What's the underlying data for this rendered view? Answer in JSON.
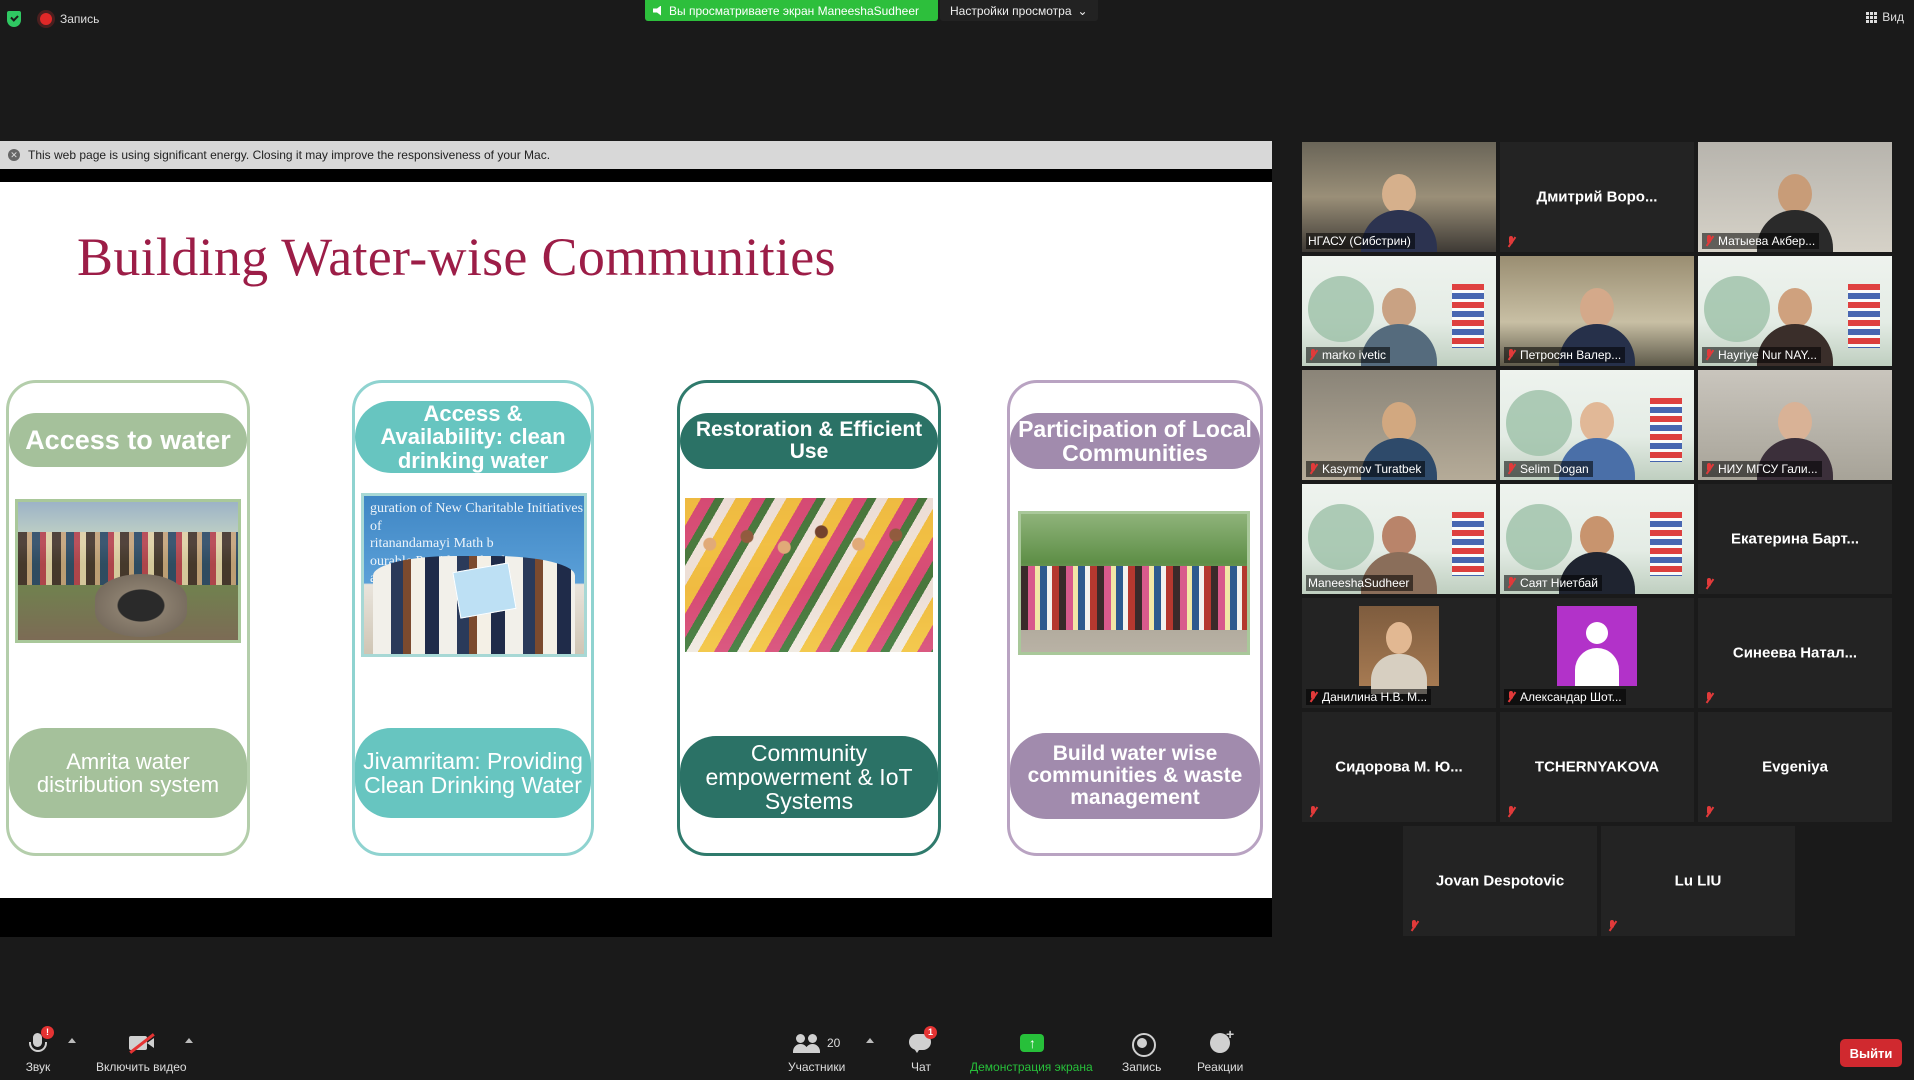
{
  "topbar": {
    "recording_label": "Запись",
    "viewing_notice": "Вы просматриваете экран ManeeshaSudheer",
    "view_options_label": "Настройки просмотра",
    "view_label": "Вид"
  },
  "browser_notice": "This web page is using significant energy. Closing it may improve the responsiveness of your Mac.",
  "slide": {
    "title": "Building Water-wise Communities",
    "columns": [
      {
        "top": "Access to water",
        "bottom": "Amrita water distribution system",
        "top_color": "#a5c19b",
        "bottom_color": "#a5c19b"
      },
      {
        "top": "Access & Availability: clean drinking water",
        "bottom": "Jivamritam: Providing Clean Drinking Water",
        "top_color": "#67c5c0",
        "bottom_color": "#67c5c0"
      },
      {
        "top": "Restoration & Efficient Use",
        "bottom": "Community empowerment & IoT Systems",
        "top_color": "#2b7266",
        "bottom_color": "#2b7266"
      },
      {
        "top": "Participation of Local Communities",
        "bottom": "Build water wise communities & waste management",
        "top_color": "#a18bad",
        "bottom_color": "#a18bad"
      }
    ],
    "photo2_banner": "guration of New Charitable Initiatives of\nritanandamayi Math b\nourable President of Indi\nath Kovind"
  },
  "participants": [
    {
      "label": "НГАСУ (Сибстрин)",
      "muted": false
    },
    {
      "name": "Дмитрий Воро...",
      "muted": true
    },
    {
      "label": "Матыева Акбер...",
      "muted": true
    },
    {
      "label": "marko ivetic",
      "muted": true
    },
    {
      "label": "Петросян Валер...",
      "muted": true
    },
    {
      "label": "Hayriye Nur NAY...",
      "muted": true
    },
    {
      "label": "Kasymov Turatbek",
      "muted": true
    },
    {
      "label": "Selim Dogan",
      "muted": true
    },
    {
      "label": "НИУ МГСУ Гали...",
      "muted": true
    },
    {
      "label": "ManeeshaSudheer",
      "muted": false
    },
    {
      "label": "Саят Ниетбай",
      "muted": true
    },
    {
      "name": "Екатерина Барт...",
      "muted": true
    },
    {
      "label": "Данилина Н.В. М...",
      "muted": true
    },
    {
      "label": "Александар Шот...",
      "muted": true
    },
    {
      "name": "Синеева Натал...",
      "muted": true
    },
    {
      "name": "Сидорова М. Ю...",
      "muted": true
    },
    {
      "name": "TCHERNYAKOVA",
      "muted": true
    },
    {
      "name": "Evgeniya",
      "muted": true
    },
    {
      "name": "Jovan Despotovic",
      "muted": true
    },
    {
      "name": "Lu LIU",
      "muted": true
    }
  ],
  "toolbar": {
    "audio_label": "Звук",
    "video_label": "Включить видео",
    "participants_label": "Участники",
    "participants_count": "20",
    "chat_label": "Чат",
    "chat_badge": "1",
    "share_label": "Демонстрация экрана",
    "record_label": "Запись",
    "reactions_label": "Реакции",
    "leave_label": "Выйти",
    "audio_badge": "!"
  }
}
